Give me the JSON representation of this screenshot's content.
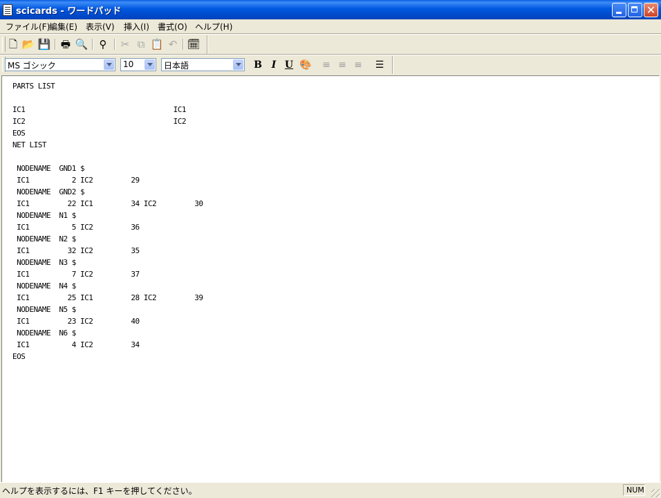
{
  "window": {
    "title": "scicards - ワードパッド"
  },
  "menu": [
    "ファイル(F)",
    "編集(E)",
    "表示(V)",
    "挿入(I)",
    "書式(O)",
    "ヘルプ(H)"
  ],
  "toolbar_icons": {
    "new": "new-document-icon",
    "open": "open-folder-icon",
    "save": "save-disk-icon",
    "print": "print-icon",
    "preview": "print-preview-icon",
    "find": "find-binoculars-icon",
    "cut": "cut-icon",
    "copy": "copy-icon",
    "paste": "paste-icon",
    "undo": "undo-icon",
    "datetime": "date-time-icon"
  },
  "format_bar": {
    "font": "MS ゴシック",
    "size": "10",
    "script": "日本語",
    "bold": "B",
    "italic": "I",
    "underline": "U"
  },
  "document": {
    "text": "PARTS LIST\n\nIC1                                   IC1\nIC2                                   IC2\nEOS\nNET LIST\n\n NODENAME  GND1 $\n IC1          2 IC2         29\n NODENAME  GND2 $\n IC1         22 IC1         34 IC2         30\n NODENAME  N1 $\n IC1          5 IC2         36\n NODENAME  N2 $\n IC1         32 IC2         35\n NODENAME  N3 $\n IC1          7 IC2         37\n NODENAME  N4 $\n IC1         25 IC1         28 IC2         39\n NODENAME  N5 $\n IC1         23 IC2         40\n NODENAME  N6 $\n IC1          4 IC2         34\nEOS"
  },
  "status": {
    "help_text": "ヘルプを表示するには、F1 キーを押してください。",
    "num": "NUM"
  },
  "colors": {
    "titlebar": "#0058E0",
    "chrome": "#ECE9D8",
    "close_button": "#C9442A"
  }
}
